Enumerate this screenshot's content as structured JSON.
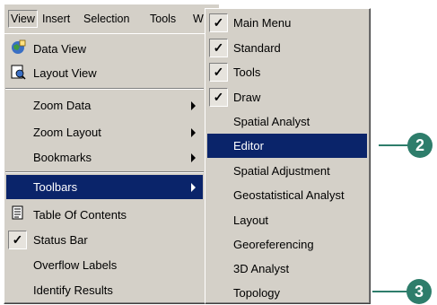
{
  "menubar": {
    "items": [
      "View",
      "Insert",
      "Selection",
      "Tools",
      "W"
    ]
  },
  "view_menu": {
    "items": [
      {
        "label": "Data View",
        "icon": "data-view-icon"
      },
      {
        "label": "Layout View",
        "icon": "layout-view-icon"
      },
      {
        "label": "Zoom Data",
        "submenu": true
      },
      {
        "label": "Zoom Layout",
        "submenu": true
      },
      {
        "label": "Bookmarks",
        "submenu": true
      },
      {
        "label": "Toolbars",
        "submenu": true,
        "highlighted": true
      },
      {
        "label": "Table Of Contents",
        "icon": "table-of-contents-icon"
      },
      {
        "label": "Status Bar",
        "checked": true
      },
      {
        "label": "Overflow Labels"
      },
      {
        "label": "Identify Results"
      }
    ]
  },
  "toolbars_menu": {
    "items": [
      {
        "label": "Main Menu",
        "checked": true
      },
      {
        "label": "Standard",
        "checked": true
      },
      {
        "label": "Tools",
        "checked": true
      },
      {
        "label": "Draw",
        "checked": true
      },
      {
        "label": "Spatial Analyst"
      },
      {
        "label": "Editor",
        "highlighted": true
      },
      {
        "label": "Spatial Adjustment"
      },
      {
        "label": "Geostatistical Analyst"
      },
      {
        "label": "Layout"
      },
      {
        "label": "Georeferencing"
      },
      {
        "label": "3D Analyst"
      },
      {
        "label": "Topology"
      }
    ]
  },
  "callouts": [
    {
      "number": "2"
    },
    {
      "number": "3"
    }
  ],
  "colors": {
    "menu_bg": "#d4d0c8",
    "highlight": "#0a246a",
    "callout": "#2e7d6b"
  }
}
